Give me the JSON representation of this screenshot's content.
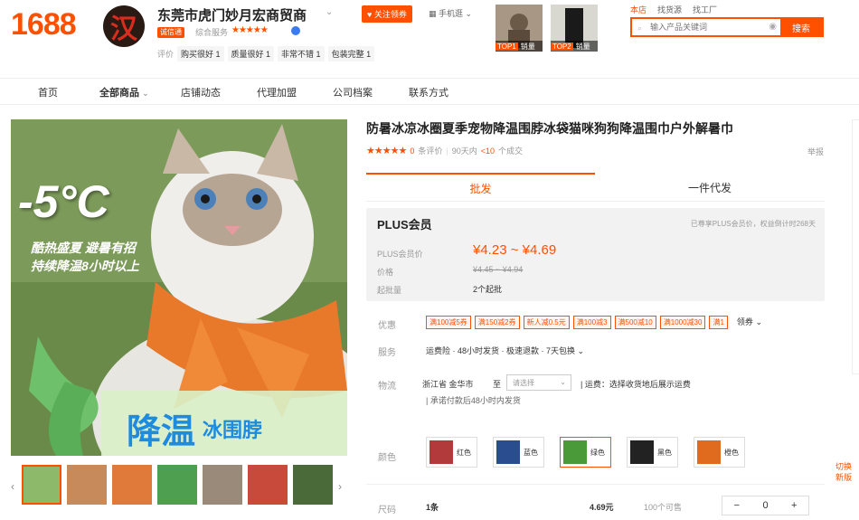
{
  "header": {
    "logo": "1688",
    "shop_avatar_char": "汉",
    "shop_name": "东莞市虎门妙月宏商贸商",
    "badge": "诚信通",
    "service_label": "综合服务",
    "stars": "★★★★★",
    "follow_label": "关注领券",
    "mobile_label": "手机逛",
    "eval_label": "评价",
    "eval_tags": [
      "购买很好 1",
      "质量很好 1",
      "非常不错 1",
      "包装完整 1"
    ],
    "top_thumbs": [
      {
        "rank": "TOP1",
        "text": "销量"
      },
      {
        "rank": "TOP2",
        "text": "销量"
      }
    ],
    "scope": [
      "本店",
      "找货源",
      "找工厂"
    ],
    "search_placeholder": "输入产品关键词",
    "search_button": "搜索"
  },
  "nav": [
    "首页",
    "全部商品",
    "店铺动态",
    "代理加盟",
    "公司档案",
    "联系方式"
  ],
  "image_text": {
    "temp": "-5°C",
    "line1": "酷热盛夏 避暑有招",
    "line2": "持续降温8小时以上",
    "bottom1": "降温",
    "bottom2": "冰围脖"
  },
  "product": {
    "title": "防暑冰凉冰圈夏季宠物降温围脖冰袋猫咪狗狗降温围巾户外解暑巾",
    "stars": "★★★★★",
    "rating_count": "0",
    "rating_label": "条评价",
    "sold_label": "90天内",
    "sold": "<10",
    "sold_suffix": "个成交",
    "report": "举报"
  },
  "tabs": [
    "批发",
    "一件代发"
  ],
  "plus": {
    "title": "PLUS会员",
    "note": "已尊享PLUS会员价，权益倒计时268天",
    "plus_price_label": "PLUS会员价",
    "plus_price": "¥4.23 ~ ¥4.69",
    "price_label": "价格",
    "price": "¥4.45 ~ ¥4.94",
    "moq_label": "起批量",
    "moq": "2个起批"
  },
  "discount": {
    "label": "优惠",
    "coupons": [
      "满100减5券",
      "满150减2券",
      "新人减0.5元",
      "满100减3",
      "满500减10",
      "满1000减30",
      "满1"
    ],
    "more": "领券"
  },
  "service": {
    "label": "服务",
    "text": "运费险 · 48小时发货 · 极速退款 · 7天包换"
  },
  "logistics": {
    "label": "物流",
    "from": "浙江省 金华市",
    "to": "至",
    "select": "请选择",
    "fee": "运费：选择收货地后展示运费",
    "promise": "承诺付款后48小时内发货"
  },
  "colors": {
    "label": "颜色",
    "items": [
      {
        "name": "红色",
        "hex": "#b23a3a"
      },
      {
        "name": "蓝色",
        "hex": "#2a4d8f"
      },
      {
        "name": "绿色",
        "hex": "#4a9a3a"
      },
      {
        "name": "黑色",
        "hex": "#222222"
      },
      {
        "name": "橙色",
        "hex": "#e06a1e"
      }
    ],
    "selected": 2
  },
  "size": {
    "label": "尺码",
    "value": "1条",
    "price": "4.69元",
    "stock": "100个可售",
    "qty": "0"
  },
  "switch_new": [
    "切换",
    "新版"
  ],
  "accent": "#ff5000"
}
